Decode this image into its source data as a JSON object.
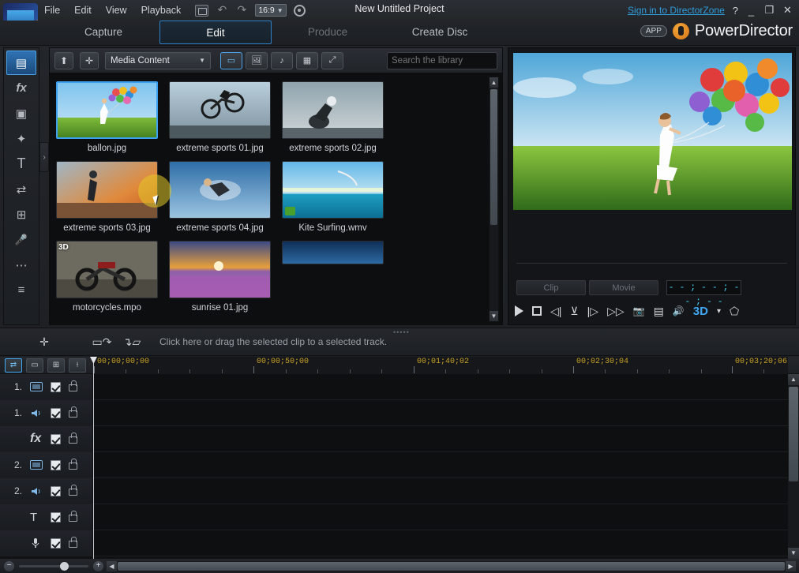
{
  "titlebar": {
    "menus": [
      "File",
      "Edit",
      "View",
      "Playback"
    ],
    "aspect_ratio": "16:9",
    "project_title": "New Untitled Project",
    "signin_link": "Sign in to DirectorZone",
    "help": "?",
    "minimize": "_",
    "maximize": "❐",
    "close": "✕"
  },
  "tabs": [
    {
      "label": "Capture",
      "state": "normal"
    },
    {
      "label": "Edit",
      "state": "active"
    },
    {
      "label": "Produce",
      "state": "dim"
    },
    {
      "label": "Create Disc",
      "state": "normal"
    }
  ],
  "brand": {
    "app_badge": "APP",
    "name": "PowerDirector"
  },
  "rail": {
    "items": [
      {
        "name": "media-room",
        "glyph": "▤",
        "selected": true
      },
      {
        "name": "effect-room",
        "glyph": "fx",
        "selected": false
      },
      {
        "name": "pip-room",
        "glyph": "▣",
        "selected": false
      },
      {
        "name": "particle-room",
        "glyph": "✦",
        "selected": false
      },
      {
        "name": "title-room",
        "glyph": "T",
        "selected": false
      },
      {
        "name": "transition-room",
        "glyph": "⇄",
        "selected": false
      },
      {
        "name": "subtitle-room",
        "glyph": "⊞",
        "selected": false
      },
      {
        "name": "voice-over-room",
        "glyph": "🎤",
        "selected": false
      },
      {
        "name": "chapter-room",
        "glyph": "⋯",
        "selected": false
      },
      {
        "name": "notes-room",
        "glyph": "≡",
        "selected": false
      }
    ],
    "expand_glyph": "›"
  },
  "library": {
    "toolbar": {
      "import_label": "⬆",
      "plugin_label": "✛",
      "media_filter": "Media Content",
      "caret": "▼",
      "view_buttons": [
        {
          "name": "all-media-filter",
          "glyph": "▭",
          "on": true
        },
        {
          "name": "image-filter",
          "glyph": "🖼",
          "on": false
        },
        {
          "name": "audio-filter",
          "glyph": "♪",
          "on": false
        },
        {
          "name": "grid-view",
          "glyph": "▦",
          "on": false
        },
        {
          "name": "detail-view",
          "glyph": "⤢",
          "on": false
        }
      ],
      "search_placeholder": "Search the library",
      "search_value": ""
    },
    "items": [
      {
        "name": "ballon.jpg",
        "selected": true,
        "badge": "",
        "type": "image"
      },
      {
        "name": "extreme sports 01.jpg",
        "selected": false,
        "badge": "",
        "type": "image"
      },
      {
        "name": "extreme sports 02.jpg",
        "selected": false,
        "badge": "",
        "type": "image"
      },
      {
        "name": "extreme sports 03.jpg",
        "selected": false,
        "badge": "",
        "type": "image"
      },
      {
        "name": "extreme sports 04.jpg",
        "selected": false,
        "badge": "",
        "type": "image"
      },
      {
        "name": "Kite Surfing.wmv",
        "selected": false,
        "badge": "wmv",
        "type": "video"
      },
      {
        "name": "motorcycles.mpo",
        "selected": false,
        "badge": "3D",
        "type": "image"
      },
      {
        "name": "sunrise 01.jpg",
        "selected": false,
        "badge": "",
        "type": "image"
      }
    ],
    "scroll_up": "▲",
    "scroll_down": "▼"
  },
  "preview": {
    "clip_tab": "Clip",
    "movie_tab": "Movie",
    "timecode": "- - ; - - ; - - ; - -",
    "transport": [
      {
        "name": "play-button",
        "glyph": "▶"
      },
      {
        "name": "stop-button",
        "glyph": "■"
      },
      {
        "name": "previous-frame-button",
        "glyph": "◁|"
      },
      {
        "name": "mark-button",
        "glyph": "⊻"
      },
      {
        "name": "next-frame-button",
        "glyph": "|▷"
      },
      {
        "name": "fast-forward-button",
        "glyph": "▷▷"
      },
      {
        "name": "snapshot-button",
        "glyph": "📷"
      },
      {
        "name": "display-options-button",
        "glyph": "▤"
      },
      {
        "name": "volume-button",
        "glyph": "🔊"
      },
      {
        "name": "3d-mode-button",
        "glyph": "3D"
      },
      {
        "name": "3d-caret",
        "glyph": "▾"
      },
      {
        "name": "free-view-button",
        "glyph": "⬠"
      }
    ]
  },
  "midbar": {
    "hint": "Click here or drag the selected clip to a selected track.",
    "magic_tool": "✛",
    "insert_tool": "▭↷",
    "overwrite_tool": "↴▱"
  },
  "timeline": {
    "toolbar": [
      {
        "name": "timeline-view-button",
        "glyph": "⇄",
        "on": true
      },
      {
        "name": "storyboard-view-button",
        "glyph": "▭",
        "on": false
      },
      {
        "name": "track-manager-button",
        "glyph": "⊞",
        "on": false
      },
      {
        "name": "sync-button",
        "glyph": "⟊",
        "on": false
      }
    ],
    "ruler_labels": [
      "00;00;00;00",
      "00;00;50;00",
      "00;01;40;02",
      "00;02;30;04",
      "00;03;20;06"
    ],
    "tracks": [
      {
        "number": "1.",
        "icon": "video",
        "checked": true,
        "locked": true
      },
      {
        "number": "1.",
        "icon": "audio",
        "checked": true,
        "locked": true
      },
      {
        "number": "",
        "icon": "fx",
        "checked": true,
        "locked": true
      },
      {
        "number": "2.",
        "icon": "video",
        "checked": true,
        "locked": true
      },
      {
        "number": "2.",
        "icon": "audio",
        "checked": true,
        "locked": true
      },
      {
        "number": "",
        "icon": "title",
        "checked": true,
        "locked": true
      },
      {
        "number": "",
        "icon": "voice",
        "checked": true,
        "locked": true
      }
    ],
    "scroll_up": "▲",
    "scroll_down": "▼",
    "zoom_out": "−",
    "zoom_in": "+",
    "scroll_left": "◀",
    "scroll_right": "▶"
  },
  "colors": {
    "accent": "#3fa9f5",
    "link": "#2e9ddb",
    "ruler_text": "#c9a227",
    "timecode": "#49d0f5"
  }
}
